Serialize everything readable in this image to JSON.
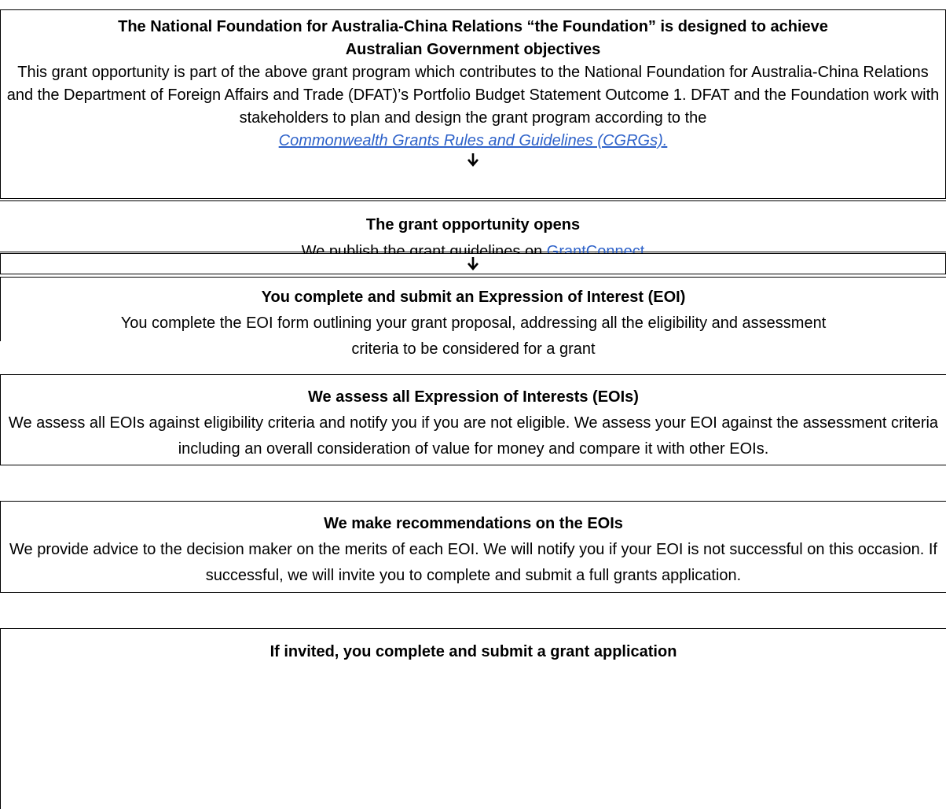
{
  "steps": [
    {
      "title": "The National Foundation for Australia-China Relations “the Foundation” is designed to achieve Australian Government objectives",
      "body": "This grant opportunity is part of the above grant program which contributes to the National Foundation for Australia-China Relations and the Department of Foreign Affairs and Trade (DFAT)’s Portfolio Budget Statement Outcome 1. DFAT and the Foundation work with stakeholders to plan and design the grant program according to the",
      "link": "Commonwealth Grants Rules and Guidelines (CGRGs)."
    },
    {
      "title": "The grant opportunity opens",
      "body_prefix": "We publish the grant guidelines on",
      "link": "GrantConnect"
    },
    {
      "title": "You complete and submit an Expression of Interest (EOI)",
      "body": "You complete the EOI form outlining your grant proposal, addressing all the eligibility and assessment criteria to be considered for a grant"
    },
    {
      "title": "We assess all Expression of Interests (EOIs)",
      "body": "We assess all EOIs against eligibility criteria and notify you if you are not eligible.  We assess your EOI against the assessment criteria including an overall consideration of value for money and compare it with other EOIs."
    },
    {
      "title": "We make recommendations on the EOIs",
      "body": "We provide advice to the decision maker on the merits of each EOI.  We will notify you if your EOI is not successful on this occasion.  If successful, we will invite you to complete and submit a full grants application."
    },
    {
      "title": "If invited, you complete and submit a grant application"
    }
  ],
  "icons": {
    "arrow": "down-arrow-icon"
  }
}
